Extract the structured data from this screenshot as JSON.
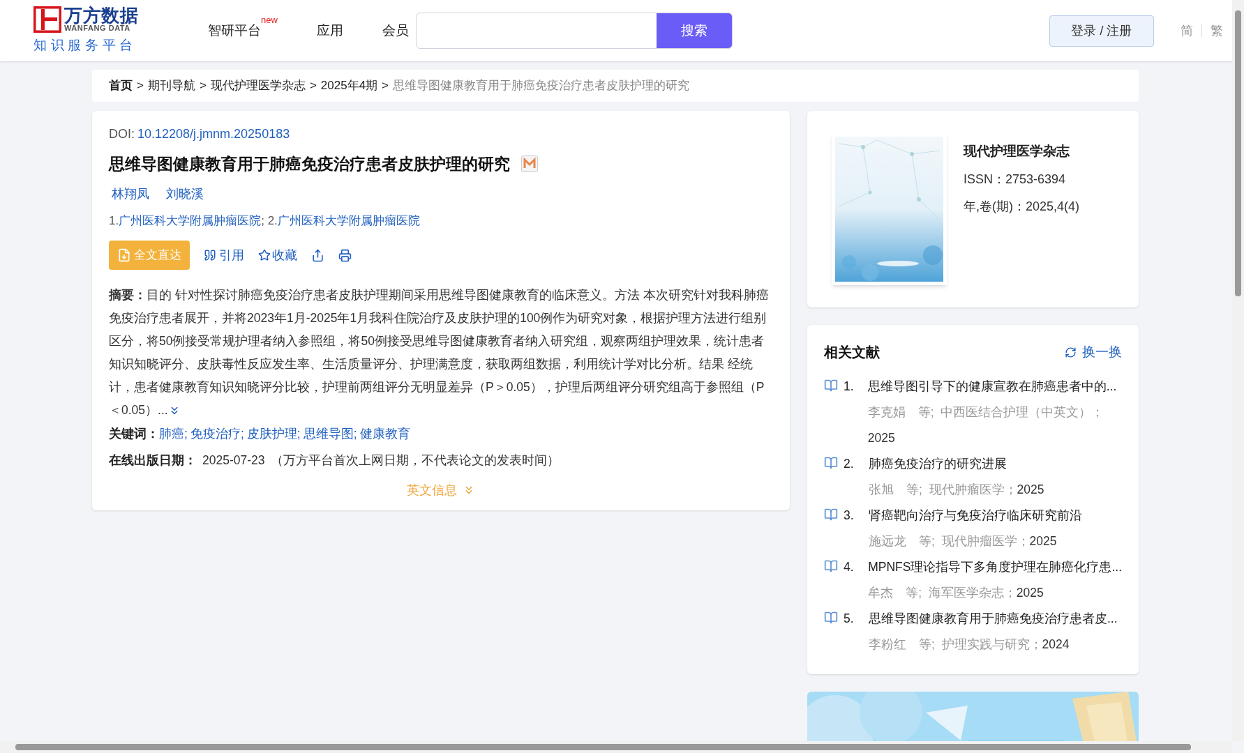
{
  "header": {
    "logo": {
      "name": "万方数据",
      "subtitle": "WANFANG DATA",
      "tagline": "知识服务平台"
    },
    "nav": [
      {
        "label": "智研平台",
        "badge": "new"
      },
      {
        "label": "应用"
      },
      {
        "label": "会员"
      }
    ],
    "search": {
      "button": "搜索"
    },
    "login": "登录 / 注册",
    "languages": [
      {
        "label": "简"
      },
      {
        "label": "繁"
      }
    ]
  },
  "breadcrumb": {
    "items": [
      "首页",
      "期刊导航",
      "现代护理医学杂志",
      "2025年4期"
    ],
    "separator": ">",
    "current": "思维导图健康教育用于肺癌免疫治疗患者皮肤护理的研究"
  },
  "article": {
    "doi_label": "DOI:",
    "doi": "10.12208/j.jmnm.20250183",
    "title": "思维导图健康教育用于肺癌免疫治疗患者皮肤护理的研究",
    "authors": [
      "林翔凤",
      "刘晓溪"
    ],
    "affiliations": [
      {
        "prefix": "1.",
        "name": "广州医科大学附属肿瘤医院"
      },
      {
        "prefix": "; 2.",
        "name": "广州医科大学附属肿瘤医院"
      }
    ],
    "actions": [
      {
        "kind": "fulltext",
        "label": "全文直达"
      },
      {
        "kind": "cite",
        "label": "引用"
      },
      {
        "kind": "favorite",
        "label": "收藏"
      },
      {
        "kind": "share"
      },
      {
        "kind": "print"
      }
    ],
    "abstract_label": "摘要：",
    "abstract": "目的 针对性探讨肺癌免疫治疗患者皮肤护理期间采用思维导图健康教育的临床意义。方法 本次研究针对我科肺癌免疫治疗患者展开，并将2023年1月-2025年1月我科住院治疗及皮肤护理的100例作为研究对象，根据护理方法进行组别区分，将50例接受常规护理者纳入参照组，将50例接受思维导图健康教育者纳入研究组，观察两组护理效果，统计患者知识知晓评分、皮肤毒性反应发生率、生活质量评分、护理满意度，获取两组数据，利用统计学对比分析。结果 经统计，患者健康教育知识知晓评分比较，护理前两组评分无明显差异（P＞0.05），护理后两组评分研究组高于参照组（P＜0.05）...",
    "keywords_label": "关键词：",
    "keyword_separator": ";",
    "keywords": [
      "肺癌",
      "免疫治疗",
      "皮肤护理",
      "思维导图",
      "健康教育"
    ],
    "date_label": "在线出版日期：",
    "date": "2025-07-23",
    "date_note": "（万方平台首次上网日期，不代表论文的发表时间）",
    "english_toggle": "英文信息"
  },
  "journal": {
    "name": "现代护理医学杂志",
    "issn": "ISSN：2753-6394",
    "issue": "年,卷(期)：2025,4(4)"
  },
  "related": {
    "title": "相关文献",
    "refresh": "换一换",
    "items": [
      {
        "number": "1.",
        "title": "思维导图引导下的健康宣教在肺癌患者中的...",
        "meta": "李克娟　等;  中西医结合护理（中英文）；",
        "year": "2025"
      },
      {
        "number": "2.",
        "title": "肺癌免疫治疗的研究进展",
        "meta": "张旭　等;  现代肿瘤医学；",
        "year": "2025"
      },
      {
        "number": "3.",
        "title": "肾癌靶向治疗与免疫治疗临床研究前沿",
        "meta": "施远龙　等;  现代肿瘤医学；",
        "year": "2025"
      },
      {
        "number": "4.",
        "title": "MPNFS理论指导下多角度护理在肺癌化疗患...",
        "meta": "牟杰　等;  海军医学杂志；",
        "year": "2025"
      },
      {
        "number": "5.",
        "title": "思维导图健康教育用于肺癌免疫治疗患者皮...",
        "meta": "李粉红　等;  护理实践与研究；",
        "year": "2024"
      }
    ]
  }
}
